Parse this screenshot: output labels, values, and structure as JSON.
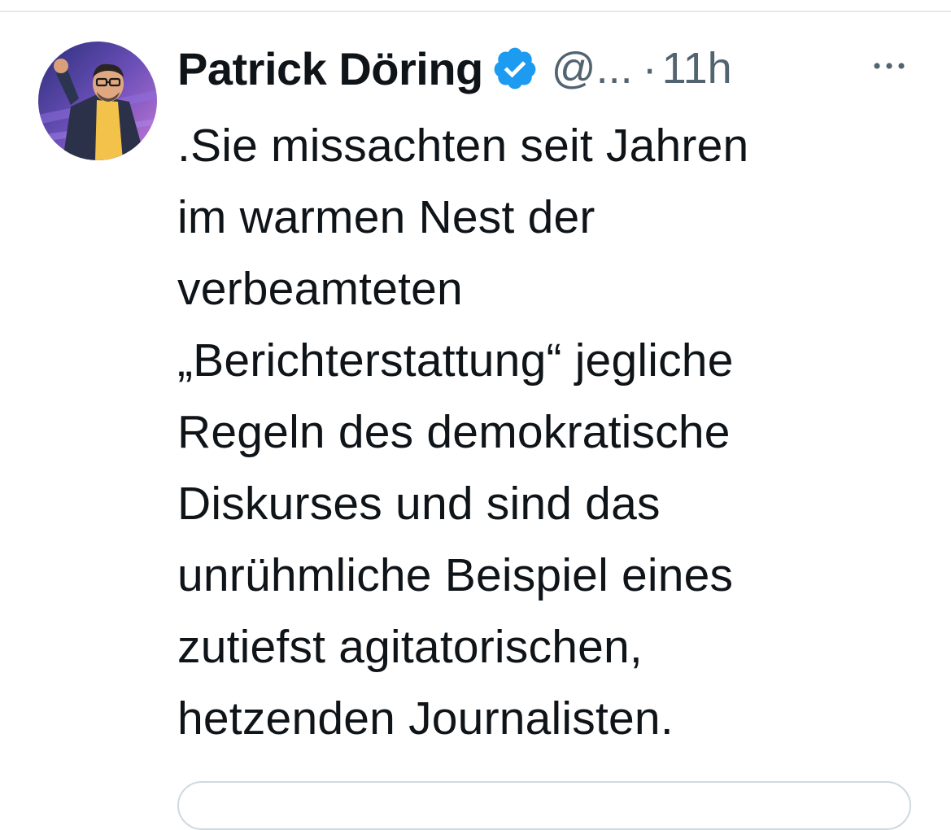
{
  "tweet": {
    "author": {
      "display_name": "Patrick Döring",
      "verified": true,
      "handle": "@...",
      "avatar_icon": "profile-photo"
    },
    "separator": "·",
    "timestamp": "11h",
    "more_icon": "more-dots-icon",
    "text": ".Sie missachten seit Jahren\nim warmen Nest der\nverbeamteten\n„Berichterstattung“ jegliche\nRegeln des demokratische\nDiskurses und sind das\nunrühmliche Beispiel eines\nzutiefst agitatorischen,\nhetzenden Journalisten."
  },
  "colors": {
    "text_primary": "#0f1419",
    "text_secondary": "#536471",
    "verified_blue": "#1d9bf0",
    "divider": "#e6e9ec",
    "card_border": "#cfd9de"
  }
}
